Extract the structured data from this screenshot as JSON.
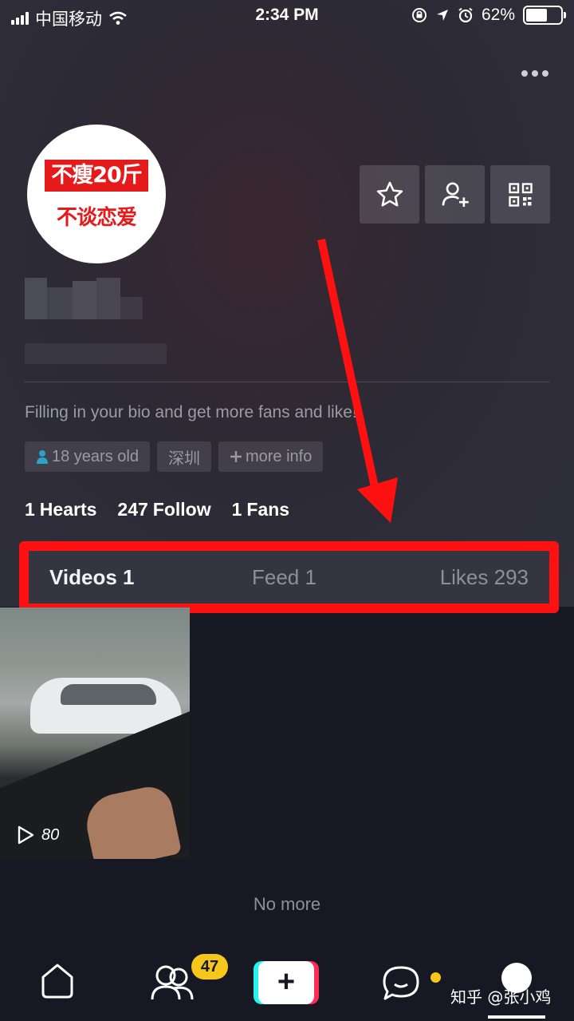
{
  "status_bar": {
    "carrier": "中国移动",
    "time": "2:34 PM",
    "battery": "62%",
    "battery_level": 0.62
  },
  "profile": {
    "avatar_line1": "不瘦20斤",
    "avatar_line2": "不谈恋爱",
    "bio": "Filling in your bio and get more fans and like!",
    "tags": [
      "18 years old",
      "深圳",
      "more info"
    ],
    "stats": [
      {
        "value": "1",
        "label": "Hearts"
      },
      {
        "value": "247",
        "label": "Follow"
      },
      {
        "value": "1",
        "label": "Fans"
      }
    ],
    "action_icons": [
      "star-icon",
      "add-user-icon",
      "qr-code-icon"
    ]
  },
  "tabs": {
    "videos": "Videos 1",
    "feed": "Feed 1",
    "likes": "Likes 293"
  },
  "video": {
    "play_count": "80"
  },
  "list_end": "No more",
  "nav": {
    "friends_badge": "47",
    "watermark": "知乎 @张小鸡"
  },
  "colors": {
    "background": "#161823",
    "highlight_red": "#ff1111",
    "badge_yellow": "#f6c61b",
    "avatar_red": "#e51a1a"
  }
}
